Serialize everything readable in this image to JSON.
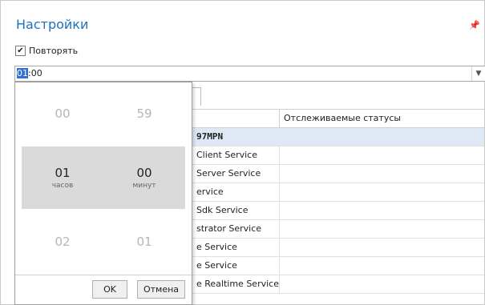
{
  "header": {
    "title": "Настройки",
    "pin_icon": "pin-icon"
  },
  "repeat": {
    "label": "Повторять",
    "checked": true
  },
  "time_field": {
    "value_selected": "01",
    "value_rest": ":00"
  },
  "grid": {
    "column_header": "Отслеживаемые статусы",
    "group_row": "97MPN",
    "rows": [
      "Client Service",
      "Server Service",
      "ervice",
      "Sdk Service",
      "strator Service",
      "e Service",
      "e Service",
      "e Realtime Service"
    ]
  },
  "picker": {
    "hours": {
      "prev": "00",
      "current": "01",
      "next": "02",
      "unit": "часов"
    },
    "minutes": {
      "prev": "59",
      "current": "00",
      "next": "01",
      "unit": "минут"
    },
    "ok_label": "OK",
    "cancel_label": "Отмена"
  }
}
